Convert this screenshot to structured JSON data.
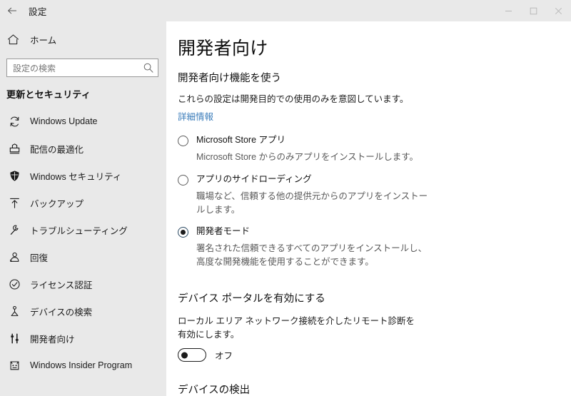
{
  "titlebar": {
    "back_icon": "back-arrow-icon",
    "title": "設定",
    "minimize_icon": "minimize-icon",
    "maximize_icon": "maximize-icon",
    "close_icon": "close-icon"
  },
  "sidebar": {
    "home": {
      "icon": "home-icon",
      "label": "ホーム"
    },
    "search": {
      "placeholder": "設定の検索",
      "value": "",
      "icon": "search-icon"
    },
    "section_title": "更新とセキュリティ",
    "items": [
      {
        "label": "Windows Update",
        "icon": "sync-icon",
        "selected": false
      },
      {
        "label": "配信の最適化",
        "icon": "delivery-optimization-icon",
        "selected": false
      },
      {
        "label": "Windows セキュリティ",
        "icon": "shield-icon",
        "selected": false
      },
      {
        "label": "バックアップ",
        "icon": "backup-upload-icon",
        "selected": false
      },
      {
        "label": "トラブルシューティング",
        "icon": "wrench-icon",
        "selected": false
      },
      {
        "label": "回復",
        "icon": "recovery-icon",
        "selected": false
      },
      {
        "label": "ライセンス認証",
        "icon": "check-circle-icon",
        "selected": false
      },
      {
        "label": "デバイスの検索",
        "icon": "find-device-icon",
        "selected": false
      },
      {
        "label": "開発者向け",
        "icon": "developer-tools-icon",
        "selected": true
      },
      {
        "label": "Windows Insider Program",
        "icon": "insider-cat-icon",
        "selected": false
      }
    ]
  },
  "main": {
    "page_title": "開発者向け",
    "feature_heading": "開発者向け機能を使う",
    "feature_description": "これらの設定は開発目的での使用のみを意図しています。",
    "more_info_link": "詳細情報",
    "options": [
      {
        "label": "Microsoft Store アプリ",
        "description": "Microsoft Store からのみアプリをインストールします。",
        "checked": false
      },
      {
        "label": "アプリのサイドローディング",
        "description": "職場など、信頼する他の提供元からのアプリをインストールします。",
        "checked": false
      },
      {
        "label": "開発者モード",
        "description": "署名された信頼できるすべてのアプリをインストールし、高度な開発機能を使用することができます。",
        "checked": true
      }
    ],
    "device_portal": {
      "heading": "デバイス ポータルを有効にする",
      "description": "ローカル エリア ネットワーク接続を介したリモート診断を有効にします。",
      "toggle_state": "オフ",
      "toggle_on": false
    },
    "device_discovery": {
      "heading": "デバイスの検出"
    }
  },
  "colors": {
    "sidebar_bg": "#e9e9e9",
    "content_bg": "#ffffff",
    "link": "#3d7ebb",
    "text_primary": "#1b1b1b",
    "text_secondary": "#595959",
    "accent_radio": "#2b4a63"
  }
}
